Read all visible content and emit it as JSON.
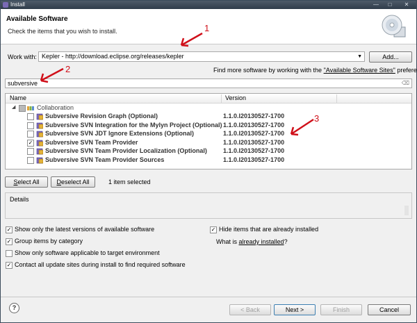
{
  "window": {
    "title": "Install"
  },
  "header": {
    "title": "Available Software",
    "subtitle": "Check the items that you wish to install."
  },
  "work_with": {
    "label": "Work with:",
    "value": "Kepler - http://download.eclipse.org/releases/kepler",
    "add_label": "Add...",
    "more_prefix": "Find more software by working with the ",
    "more_link": "\"Available Software Sites\"",
    "more_suffix": " preferences."
  },
  "filter": {
    "value": "subversive"
  },
  "tree": {
    "columns": [
      "Name",
      "Version"
    ],
    "category": "Collaboration",
    "items": [
      {
        "name": "Subversive Revision Graph (Optional)",
        "version": "1.1.0.I20130527-1700",
        "checked": false
      },
      {
        "name": "Subversive SVN Integration for the Mylyn Project (Optional)",
        "version": "1.1.0.I20130527-1700",
        "checked": false
      },
      {
        "name": "Subversive SVN JDT Ignore Extensions (Optional)",
        "version": "1.1.0.I20130527-1700",
        "checked": false
      },
      {
        "name": "Subversive SVN Team Provider",
        "version": "1.1.0.I20130527-1700",
        "checked": true
      },
      {
        "name": "Subversive SVN Team Provider Localization (Optional)",
        "version": "1.1.0.I20130527-1700",
        "checked": false
      },
      {
        "name": "Subversive SVN Team Provider Sources",
        "version": "1.1.0.I20130527-1700",
        "checked": false
      }
    ]
  },
  "selection": {
    "select_all": "Select All",
    "deselect_all": "Deselect All",
    "status": "1 item selected"
  },
  "details": {
    "label": "Details"
  },
  "options": {
    "latest": "Show only the latest versions of available software",
    "group": "Group items by category",
    "target": "Show only software applicable to target environment",
    "contact": "Contact all update sites during install to find required software",
    "hide": "Hide items that are already installed",
    "what_is": "What is ",
    "already_installed": "already installed",
    "what_is_suffix": "?"
  },
  "footer": {
    "back": "< Back",
    "next": "Next >",
    "finish": "Finish",
    "cancel": "Cancel",
    "help": "?"
  },
  "annotations": [
    "1",
    "2",
    "3"
  ],
  "colors": {
    "annotation": "#d0101a",
    "titlebar": "#3a4756"
  }
}
